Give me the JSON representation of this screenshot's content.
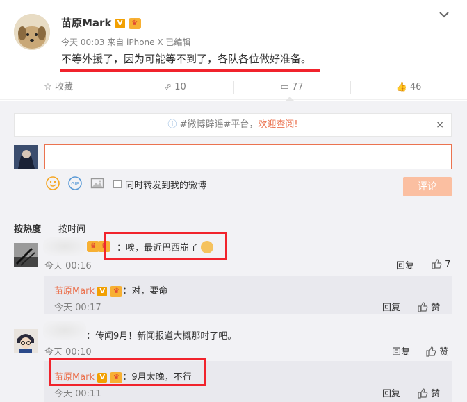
{
  "post": {
    "author": "苗原Mark",
    "verified_badge": "V",
    "meta": "今天 00:03 来自 iPhone X   已编辑",
    "text": "不等外援了，因为可能等不到了，各队各位做好准备。"
  },
  "actions": {
    "favorite_label": "收藏",
    "forward_count": "10",
    "comment_count": "77",
    "like_count": "46"
  },
  "notice": {
    "prefix": "#微博辟谣#平台，",
    "link": "欢迎查阅!",
    "close": "×"
  },
  "composer": {
    "input_value": "",
    "also_forward_label": "同时转发到我的微博",
    "submit_label": "评论"
  },
  "sort": {
    "hot": "按热度",
    "time": "按时间"
  },
  "comments": [
    {
      "text": "：唉，最近巴西崩了",
      "time": "今天 00:16",
      "reply": "回复",
      "likes": "7",
      "sub": {
        "name": "苗原Mark",
        "text": "：对，要命",
        "time": "今天 00:17",
        "reply": "回复",
        "like": "赞"
      }
    },
    {
      "text": "：传闻9月！新闻报道大概那时了吧。",
      "time": "今天 00:10",
      "reply": "回复",
      "like": "赞",
      "sub": {
        "name": "苗原Mark",
        "text": "：9月太晚，不行",
        "time": "今天 00:11",
        "reply": "回复",
        "like": "赞"
      }
    }
  ],
  "colors": {
    "accent": "#eb7350",
    "highlight": "#f1232c",
    "comment_bg": "#f2f2f5"
  }
}
